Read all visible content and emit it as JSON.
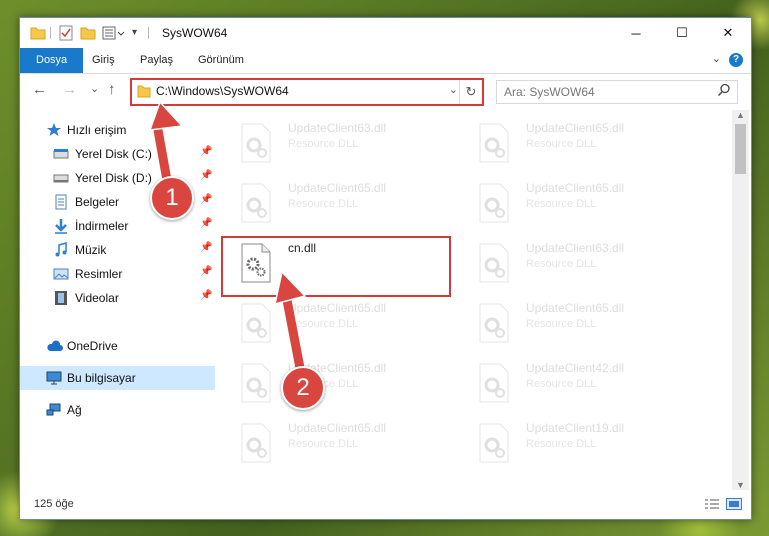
{
  "window": {
    "title": "SysWOW64"
  },
  "ribbon": {
    "tabs": [
      {
        "label": "Dosya"
      },
      {
        "label": "Giriş"
      },
      {
        "label": "Paylaş"
      },
      {
        "label": "Görünüm"
      }
    ],
    "help": "?"
  },
  "controls": {
    "minimize": "─",
    "maximize": "☐",
    "close": "✕"
  },
  "nav": {
    "back": "←",
    "forward": "→",
    "recent": "⌄",
    "up": "↑"
  },
  "address": {
    "path": "C:\\Windows\\SysWOW64",
    "dropdown": "⌄",
    "refresh": "↻"
  },
  "search": {
    "placeholder": "Ara: SysWOW64"
  },
  "sidebar": {
    "items": [
      {
        "label": "Hızlı erişim",
        "icon": "star-icon",
        "pinned": false
      },
      {
        "label": "Yerel Disk (C:)",
        "icon": "drive-icon",
        "pinned": true
      },
      {
        "label": "Yerel Disk (D:)",
        "icon": "drive-icon",
        "pinned": true
      },
      {
        "label": "Belgeler",
        "icon": "documents-icon",
        "pinned": true
      },
      {
        "label": "İndirmeler",
        "icon": "download-icon",
        "pinned": true
      },
      {
        "label": "Müzik",
        "icon": "music-icon",
        "pinned": true
      },
      {
        "label": "Resimler",
        "icon": "pictures-icon",
        "pinned": true
      },
      {
        "label": "Videolar",
        "icon": "video-icon",
        "pinned": true
      },
      {
        "label": "OneDrive",
        "icon": "cloud-icon",
        "pinned": false
      },
      {
        "label": "Bu bilgisayar",
        "icon": "computer-icon",
        "pinned": false
      },
      {
        "label": "Ağ",
        "icon": "network-icon",
        "pinned": false
      }
    ]
  },
  "files": [
    {
      "name": "UpdateClient63.dll",
      "type": "Resource DLL"
    },
    {
      "name": "UpdateClient65.dll",
      "type": "Resource DLL"
    },
    {
      "name": "UpdateClient65.dll",
      "type": "Resource DLL"
    },
    {
      "name": "UpdateClient65.dll",
      "type": "Resource DLL"
    },
    {
      "name": "cn.dll",
      "type": ""
    },
    {
      "name": "UpdateClient63.dll",
      "type": "Resource DLL"
    },
    {
      "name": "UpdateClient65.dll",
      "type": "Resource DLL"
    },
    {
      "name": "UpdateClient65.dll",
      "type": "Resource DLL"
    },
    {
      "name": "UpdateClient65.dll",
      "type": "Resource DLL"
    },
    {
      "name": "UpdateClient42.dll",
      "type": "Resource DLL"
    },
    {
      "name": "UpdateClient65.dll",
      "type": "Resource DLL"
    },
    {
      "name": "UpdateClient19.dll",
      "type": "Resource DLL"
    }
  ],
  "status": {
    "count": "125 öğe"
  },
  "annotations": {
    "step1": "1",
    "step2": "2",
    "color": "#d33a3a"
  }
}
